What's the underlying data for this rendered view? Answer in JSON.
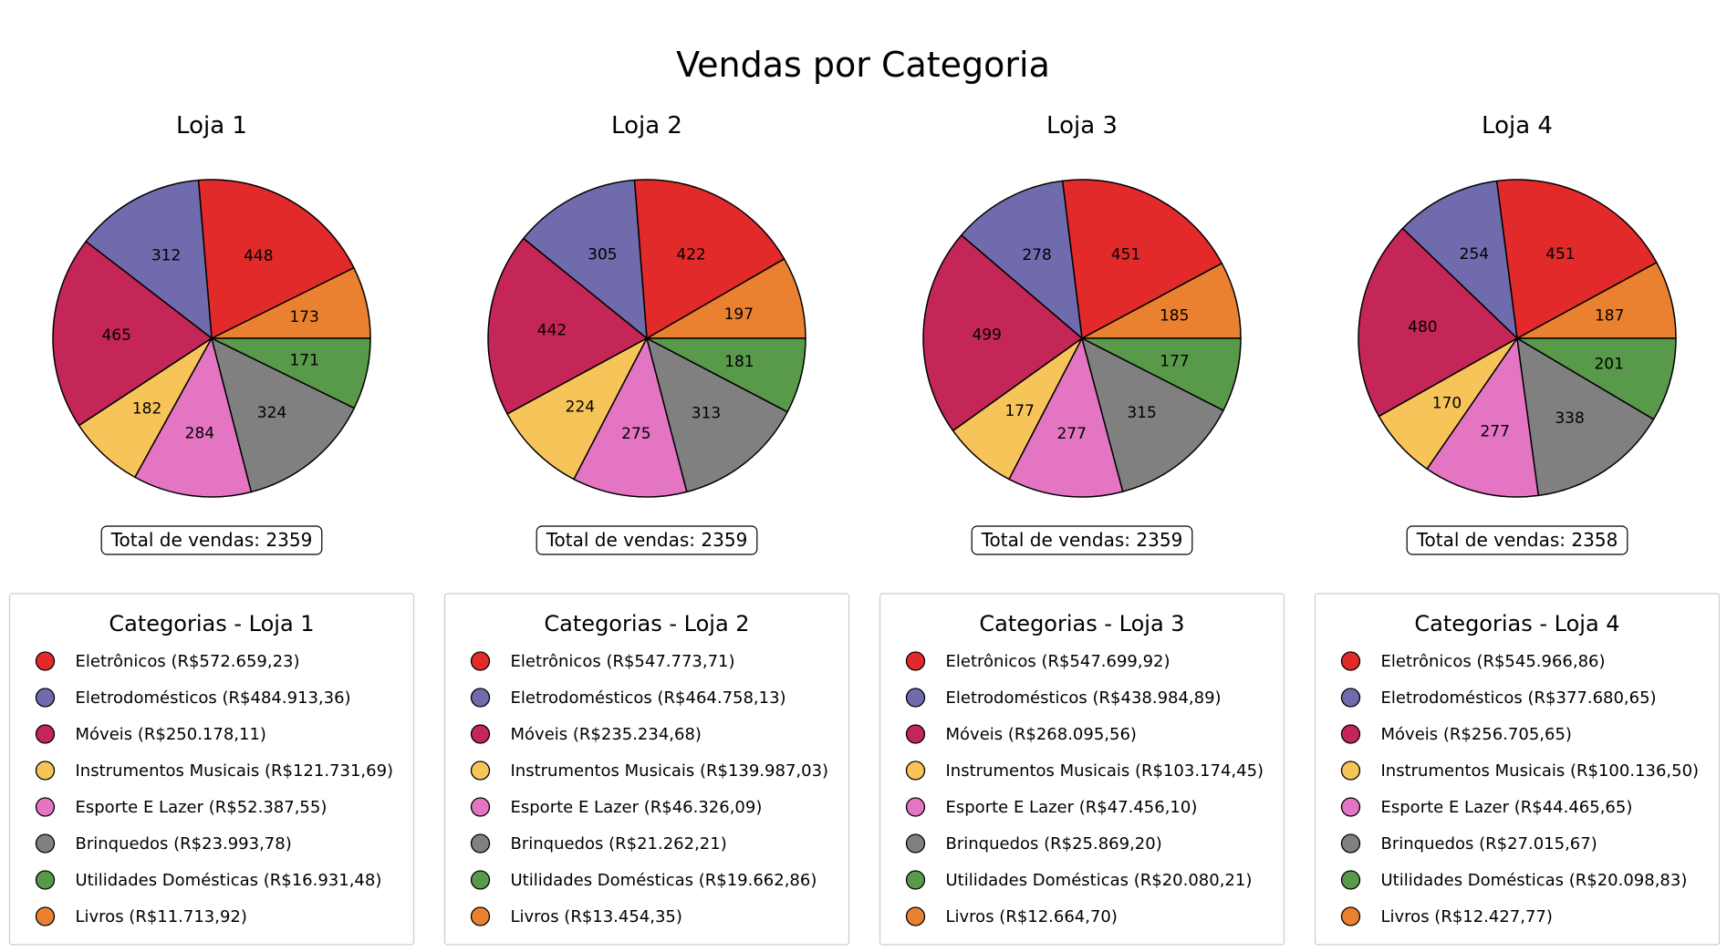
{
  "chart_data": {
    "type": "pie",
    "title": "Vendas por Categoria",
    "colors": {
      "Eletrônicos": "#e32a2b",
      "Eletrodomésticos": "#706bac",
      "Móveis": "#c42657",
      "Instrumentos Musicais": "#f7c45a",
      "Esporte E Lazer": "#e375c3",
      "Brinquedos": "#808080",
      "Utilidades Domésticas": "#58994a",
      "Livros": "#ea8131"
    },
    "pie_order": [
      "Livros",
      "Eletrônicos",
      "Eletrodomésticos",
      "Móveis",
      "Instrumentos Musicais",
      "Esporte E Lazer",
      "Brinquedos",
      "Utilidades Domésticas"
    ],
    "legend_order": [
      "Eletrônicos",
      "Eletrodomésticos",
      "Móveis",
      "Instrumentos Musicais",
      "Esporte E Lazer",
      "Brinquedos",
      "Utilidades Domésticas",
      "Livros"
    ],
    "charts": [
      {
        "title": "Loja 1",
        "total_label": "Total de vendas: 2359",
        "legend_title": "Categorias - Loja 1",
        "counts": {
          "Livros": 173,
          "Eletrônicos": 448,
          "Eletrodomésticos": 312,
          "Móveis": 465,
          "Instrumentos Musicais": 182,
          "Esporte E Lazer": 284,
          "Brinquedos": 324,
          "Utilidades Domésticas": 171
        },
        "legend": [
          "Eletrônicos (R$572.659,23)",
          "Eletrodomésticos (R$484.913,36)",
          "Móveis (R$250.178,11)",
          "Instrumentos Musicais (R$121.731,69)",
          "Esporte E Lazer (R$52.387,55)",
          "Brinquedos (R$23.993,78)",
          "Utilidades Domésticas (R$16.931,48)",
          "Livros (R$11.713,92)"
        ]
      },
      {
        "title": "Loja 2",
        "total_label": "Total de vendas: 2359",
        "legend_title": "Categorias - Loja 2",
        "counts": {
          "Livros": 197,
          "Eletrônicos": 422,
          "Eletrodomésticos": 305,
          "Móveis": 442,
          "Instrumentos Musicais": 224,
          "Esporte E Lazer": 275,
          "Brinquedos": 313,
          "Utilidades Domésticas": 181
        },
        "legend": [
          "Eletrônicos (R$547.773,71)",
          "Eletrodomésticos (R$464.758,13)",
          "Móveis (R$235.234,68)",
          "Instrumentos Musicais (R$139.987,03)",
          "Esporte E Lazer (R$46.326,09)",
          "Brinquedos (R$21.262,21)",
          "Utilidades Domésticas (R$19.662,86)",
          "Livros (R$13.454,35)"
        ]
      },
      {
        "title": "Loja 3",
        "total_label": "Total de vendas: 2359",
        "legend_title": "Categorias - Loja 3",
        "counts": {
          "Livros": 185,
          "Eletrônicos": 451,
          "Eletrodomésticos": 278,
          "Móveis": 499,
          "Instrumentos Musicais": 177,
          "Esporte E Lazer": 277,
          "Brinquedos": 315,
          "Utilidades Domésticas": 177
        },
        "legend": [
          "Eletrônicos (R$547.699,92)",
          "Eletrodomésticos (R$438.984,89)",
          "Móveis (R$268.095,56)",
          "Instrumentos Musicais (R$103.174,45)",
          "Esporte E Lazer (R$47.456,10)",
          "Brinquedos (R$25.869,20)",
          "Utilidades Domésticas (R$20.080,21)",
          "Livros (R$12.664,70)"
        ]
      },
      {
        "title": "Loja 4",
        "total_label": "Total de vendas: 2358",
        "legend_title": "Categorias - Loja 4",
        "counts": {
          "Livros": 187,
          "Eletrônicos": 451,
          "Eletrodomésticos": 254,
          "Móveis": 480,
          "Instrumentos Musicais": 170,
          "Esporte E Lazer": 277,
          "Brinquedos": 338,
          "Utilidades Domésticas": 201
        },
        "legend": [
          "Eletrônicos (R$545.966,86)",
          "Eletrodomésticos (R$377.680,65)",
          "Móveis (R$256.705,65)",
          "Instrumentos Musicais (R$100.136,50)",
          "Esporte E Lazer (R$44.465,65)",
          "Brinquedos (R$27.015,67)",
          "Utilidades Domésticas (R$20.098,83)",
          "Livros (R$12.427,77)"
        ]
      }
    ]
  }
}
